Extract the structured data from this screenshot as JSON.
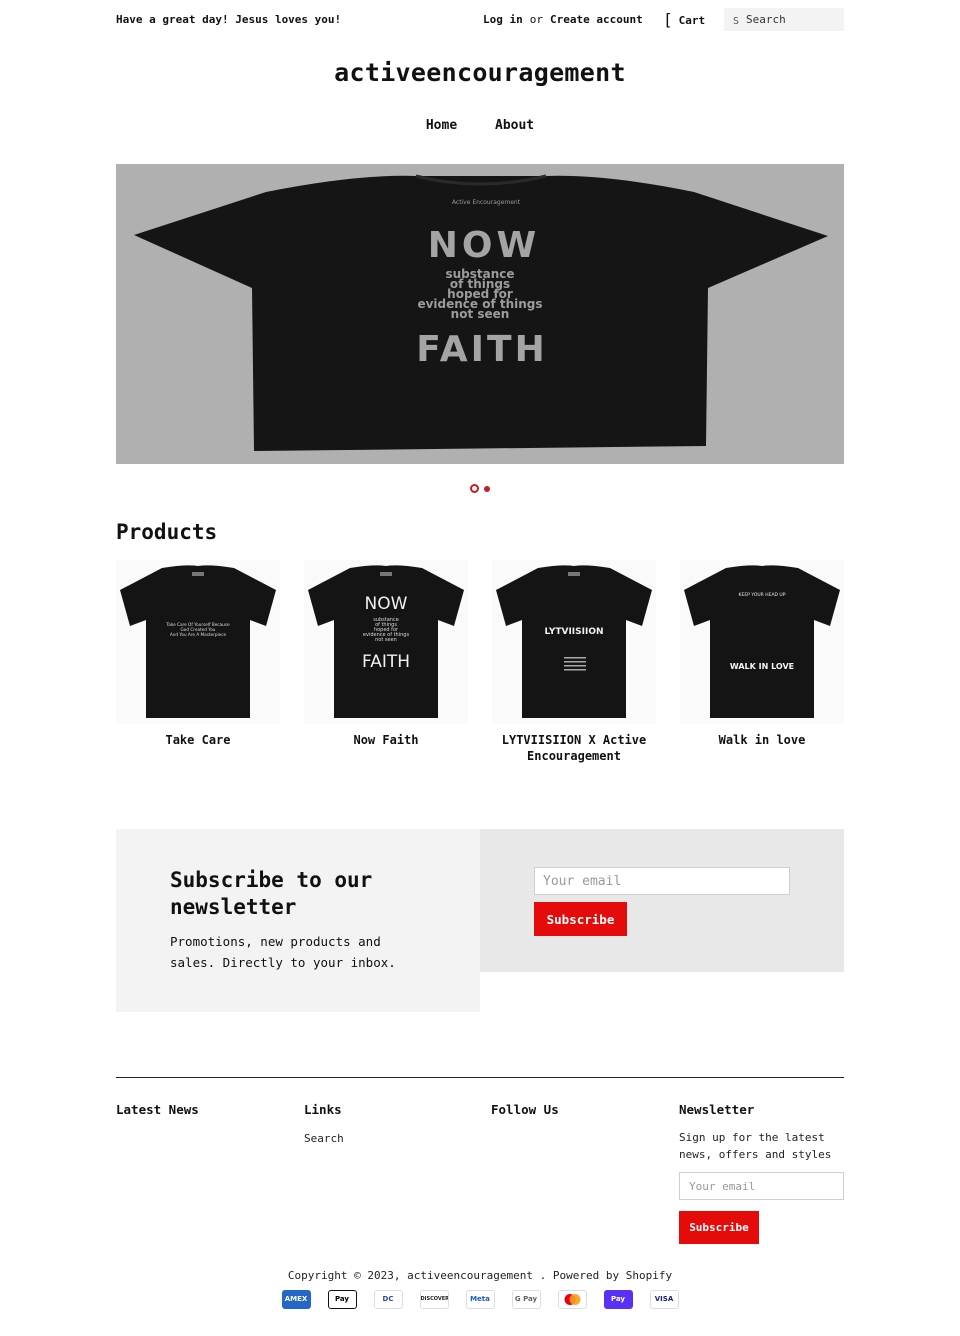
{
  "topbar": {
    "greeting": "Have a great day! Jesus loves you!",
    "login_label": "Log in",
    "or_label": "or",
    "create_account_label": "Create account",
    "cart_label": "Cart",
    "search_placeholder": "Search",
    "search_icon_glyph": "S"
  },
  "header": {
    "site_title": "activeencouragement",
    "nav": [
      "Home",
      "About"
    ]
  },
  "hero": {
    "slide_lines": [
      "NOW",
      "substance",
      "of things",
      "hoped for",
      "evidence of things",
      "not seen",
      "FAITH"
    ],
    "collar_label": "Active Encouragement",
    "background_color": "#b0b0b0",
    "slide_count": 2,
    "active_slide": 1
  },
  "products": {
    "title": "Products",
    "items": [
      {
        "name": "Take Care",
        "print": [
          "Take Care Of Yourself Because",
          "God Created You",
          "And You Are A Masterpiece"
        ]
      },
      {
        "name": "Now Faith",
        "print": [
          "NOW",
          "substance",
          "of things",
          "hoped for",
          "evidence of things",
          "not seen",
          "FAITH"
        ]
      },
      {
        "name": "LYTVIISIION X Active Encouragement",
        "print": [
          "LYTVIISIION"
        ]
      },
      {
        "name": "Walk in love",
        "print": [
          "KEEP YOUR HEAD UP",
          "WALK IN LOVE"
        ]
      }
    ]
  },
  "newsletter": {
    "title": "Subscribe to our newsletter",
    "description": "Promotions, new products and sales. Directly to your inbox.",
    "email_placeholder": "Your email",
    "button_label": "Subscribe"
  },
  "footer": {
    "latest_news_title": "Latest News",
    "links_title": "Links",
    "links": [
      "Search"
    ],
    "follow_title": "Follow Us",
    "newsletter_title": "Newsletter",
    "newsletter_text": "Sign up for the latest news, offers and styles",
    "newsletter_placeholder": "Your email",
    "newsletter_button": "Subscribe",
    "copyright_prefix": "Copyright © 2023,",
    "copyright_store": "activeencouragement",
    "copyright_powered": ". Powered by Shopify",
    "payments": [
      "AMEX",
      "Pay",
      "DC",
      "DISCOVER",
      "Meta",
      "G Pay",
      "",
      "Pay",
      "VISA"
    ],
    "payment_icons": [
      "amex-icon",
      "apple-pay-icon",
      "diners-club-icon",
      "discover-icon",
      "meta-pay-icon",
      "google-pay-icon",
      "mastercard-icon",
      "shop-pay-icon",
      "visa-icon"
    ]
  },
  "colors": {
    "accent": "#e50b0b",
    "dot": "#c51e1e",
    "panel_light": "#f3f3f3",
    "panel_mid": "#e8e8e8"
  }
}
